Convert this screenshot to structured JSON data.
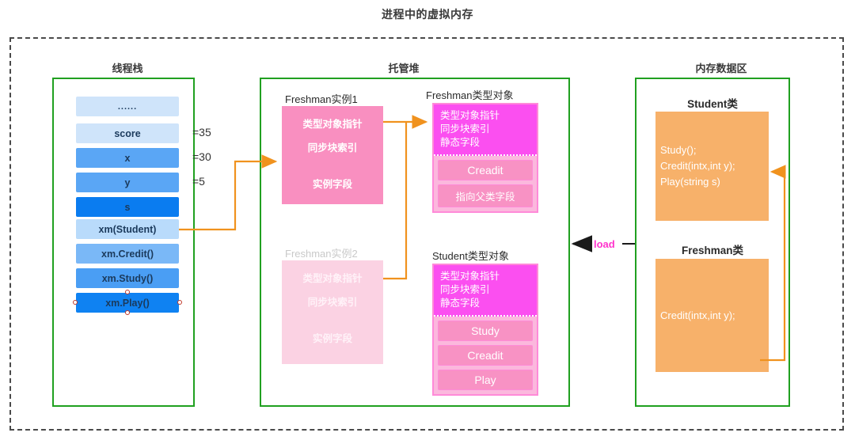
{
  "title": "进程中的虚拟内存",
  "regions": {
    "thread_stack": {
      "title": "线程栈"
    },
    "managed_heap": {
      "title": "托管堆"
    },
    "memory_data": {
      "title": "内存数据区"
    }
  },
  "thread_stack": {
    "cells": [
      {
        "label": "......",
        "value": ""
      },
      {
        "label": "score",
        "value": "=35"
      },
      {
        "label": "x",
        "value": "=30"
      },
      {
        "label": "y",
        "value": "=5"
      },
      {
        "label": "s",
        "value": ""
      },
      {
        "label": "xm(Student)",
        "value": ""
      },
      {
        "label": "xm.Credit()",
        "value": ""
      },
      {
        "label": "xm.Study()",
        "value": ""
      },
      {
        "label": "xm.Play()",
        "value": ""
      }
    ]
  },
  "heap": {
    "freshman_instance_1": {
      "label": "Freshman实例1",
      "line1": "类型对象指针",
      "line2": "同步块索引",
      "line3": "实例字段"
    },
    "freshman_instance_2": {
      "label": "Freshman实例2",
      "line1": "类型对象指针",
      "line2": "同步块索引",
      "line3": "实例字段"
    },
    "freshman_type_object": {
      "label": "Freshman类型对象",
      "head1": "类型对象指针",
      "head2": "同步块索引",
      "head3": "静态字段",
      "rows": [
        "Creadit",
        "指向父类字段"
      ]
    },
    "student_type_object": {
      "label": "Student类型对象",
      "head1": "类型对象指针",
      "head2": "同步块索引",
      "head3": "静态字段",
      "rows": [
        "Study",
        "Creadit",
        "Play"
      ]
    }
  },
  "memory_data": {
    "student_class": {
      "title": "Student类",
      "lines": [
        "Study();",
        "Credit(intx,int y);",
        "Play(string s)"
      ]
    },
    "freshman_class": {
      "title": "Freshman类",
      "lines": [
        "Credit(intx,int y);"
      ]
    }
  },
  "connectors": {
    "load_label": "load"
  },
  "colors": {
    "green_frame": "#20a020",
    "dashed_boundary": "#4a4a4a",
    "orange_wire": "#f0921e",
    "pink_instance": "#f98fc0",
    "magenta_type": "#fb4ff0",
    "orange_class": "#f7b16a",
    "load_magenta": "#ff33cc"
  }
}
